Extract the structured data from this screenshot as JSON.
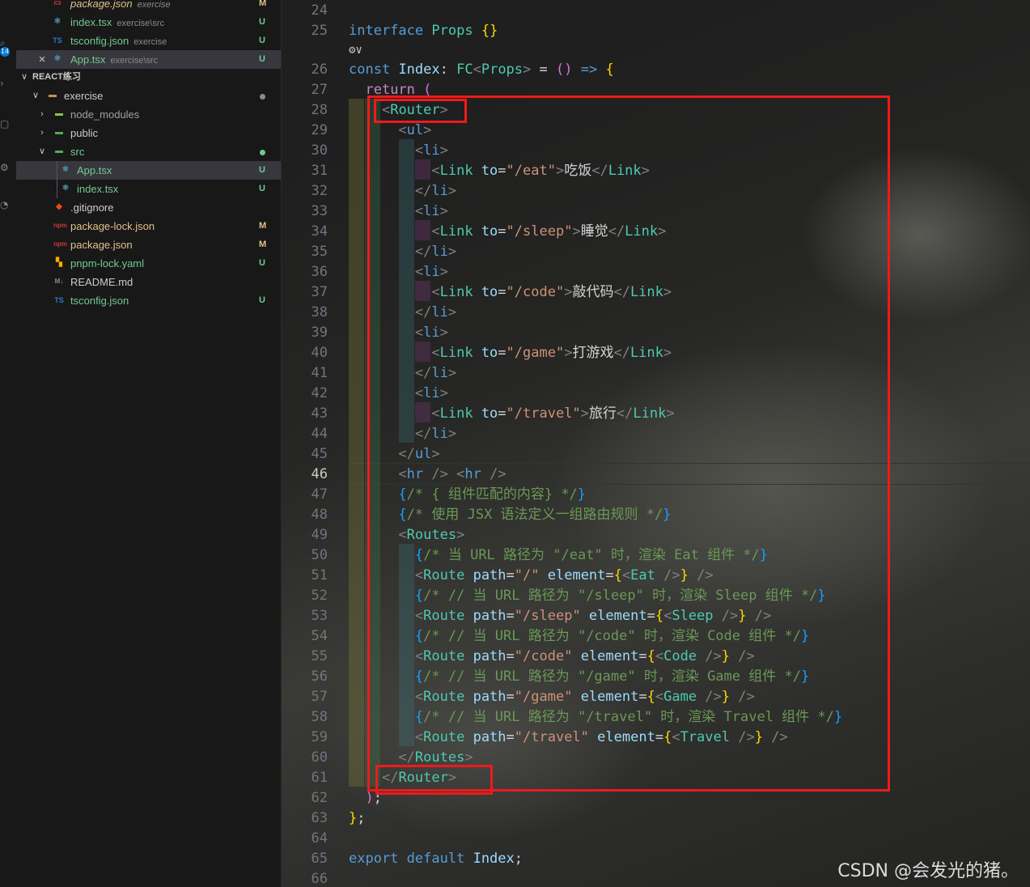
{
  "activity_bar": {
    "badge": "14",
    "icons": [
      "explorer-icon",
      "search-icon",
      "source-control-icon",
      "run-debug-icon",
      "extensions-icon",
      "remote-icon"
    ]
  },
  "open_editors": [
    {
      "name": "package.json",
      "desc": "exercise",
      "status": "M",
      "icon": "json-icon"
    },
    {
      "name": "index.tsx",
      "desc": "exercise\\src",
      "status": "U",
      "icon": "react-icon"
    },
    {
      "name": "tsconfig.json",
      "desc": "exercise",
      "status": "U",
      "icon": "ts-icon"
    },
    {
      "name": "App.tsx",
      "desc": "exercise\\src",
      "status": "U",
      "icon": "react-icon",
      "close": "×",
      "selected": true
    }
  ],
  "explorer": {
    "title": "REACT练习",
    "items": [
      {
        "name": "exercise",
        "kind": "folder",
        "open": true
      },
      {
        "name": "node_modules",
        "kind": "folder",
        "open": false
      },
      {
        "name": "public",
        "kind": "folder",
        "open": false
      },
      {
        "name": "src",
        "kind": "folder",
        "open": true
      },
      {
        "name": "App.tsx",
        "status": "U"
      },
      {
        "name": "index.tsx",
        "status": "U"
      },
      {
        "name": ".gitignore",
        "status": ""
      },
      {
        "name": "package-lock.json",
        "status": "M"
      },
      {
        "name": "package.json",
        "status": "M"
      },
      {
        "name": "pnpm-lock.yaml",
        "status": "U"
      },
      {
        "name": "README.md",
        "status": ""
      },
      {
        "name": "tsconfig.json",
        "status": "U"
      }
    ]
  },
  "editor": {
    "current_line": "46",
    "codelens": "⚙∨",
    "lines": [
      {
        "n": "24",
        "text": ""
      },
      {
        "n": "25",
        "text": "interface Props {}"
      },
      {
        "n": "26",
        "text": "const Index: FC<Props> = () => {"
      },
      {
        "n": "27",
        "text": "  return ("
      },
      {
        "n": "28",
        "text": "    <Router>"
      },
      {
        "n": "29",
        "text": "      <ul>"
      },
      {
        "n": "30",
        "text": "        <li>"
      },
      {
        "n": "31",
        "text": "          <Link to=\"/eat\">吃饭</Link>"
      },
      {
        "n": "32",
        "text": "        </li>"
      },
      {
        "n": "33",
        "text": "        <li>"
      },
      {
        "n": "34",
        "text": "          <Link to=\"/sleep\">睡觉</Link>"
      },
      {
        "n": "35",
        "text": "        </li>"
      },
      {
        "n": "36",
        "text": "        <li>"
      },
      {
        "n": "37",
        "text": "          <Link to=\"/code\">敲代码</Link>"
      },
      {
        "n": "38",
        "text": "        </li>"
      },
      {
        "n": "39",
        "text": "        <li>"
      },
      {
        "n": "40",
        "text": "          <Link to=\"/game\">打游戏</Link>"
      },
      {
        "n": "41",
        "text": "        </li>"
      },
      {
        "n": "42",
        "text": "        <li>"
      },
      {
        "n": "43",
        "text": "          <Link to=\"/travel\">旅行</Link>"
      },
      {
        "n": "44",
        "text": "        </li>"
      },
      {
        "n": "45",
        "text": "      </ul>"
      },
      {
        "n": "46",
        "text": "      <hr /> <hr />"
      },
      {
        "n": "47",
        "text": "      {/* { 组件匹配的内容} */}"
      },
      {
        "n": "48",
        "text": "      {/* 使用 JSX 语法定义一组路由规则 */}"
      },
      {
        "n": "49",
        "text": "      <Routes>"
      },
      {
        "n": "50",
        "text": "        {/* 当 URL 路径为 \"/eat\" 时，渲染 Eat 组件 */}"
      },
      {
        "n": "51",
        "text": "        <Route path=\"/\" element={<Eat />} />"
      },
      {
        "n": "52",
        "text": "        {/* // 当 URL 路径为 \"/sleep\" 时，渲染 Sleep 组件 */}"
      },
      {
        "n": "53",
        "text": "        <Route path=\"/sleep\" element={<Sleep />} />"
      },
      {
        "n": "54",
        "text": "        {/* // 当 URL 路径为 \"/code\" 时，渲染 Code 组件 */}"
      },
      {
        "n": "55",
        "text": "        <Route path=\"/code\" element={<Code />} />"
      },
      {
        "n": "56",
        "text": "        {/* // 当 URL 路径为 \"/game\" 时，渲染 Game 组件 */}"
      },
      {
        "n": "57",
        "text": "        <Route path=\"/game\" element={<Game />} />"
      },
      {
        "n": "58",
        "text": "        {/* // 当 URL 路径为 \"/travel\" 时，渲染 Travel 组件 */}"
      },
      {
        "n": "59",
        "text": "        <Route path=\"/travel\" element={<Travel />} />"
      },
      {
        "n": "60",
        "text": "      </Routes>"
      },
      {
        "n": "61",
        "text": "    </Router>"
      },
      {
        "n": "62",
        "text": "  );"
      },
      {
        "n": "63",
        "text": "};"
      },
      {
        "n": "64",
        "text": ""
      },
      {
        "n": "65",
        "text": "export default Index;"
      },
      {
        "n": "66",
        "text": ""
      }
    ]
  },
  "watermark": "CSDN @会发光的猪。",
  "colors": {
    "keyword": "#569cd6",
    "control": "#c586c0",
    "type": "#4ec9b0",
    "variable": "#9cdcfe",
    "string": "#ce9178",
    "comment": "#6a9955",
    "tag_bracket": "#808080",
    "highlight_box": "#ee1a1a"
  }
}
